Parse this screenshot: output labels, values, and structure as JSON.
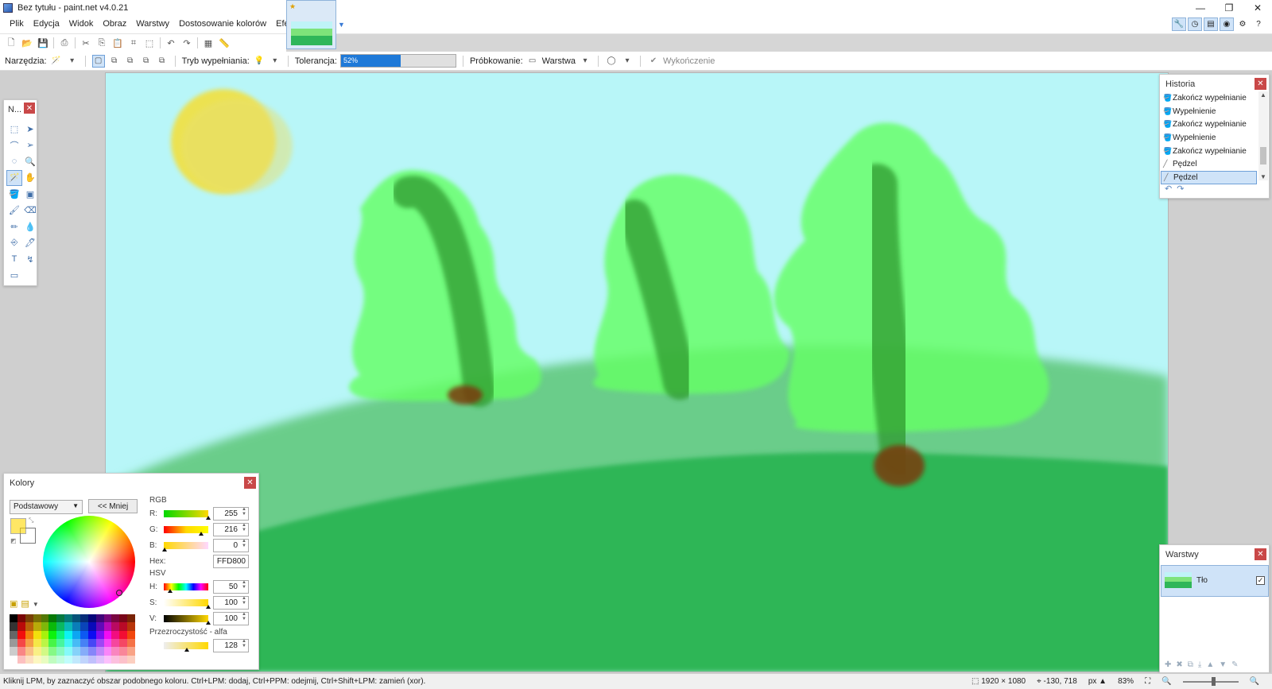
{
  "window": {
    "title": "Bez tytułu - paint.net v4.0.21"
  },
  "menu": [
    "Plik",
    "Edycja",
    "Widok",
    "Obraz",
    "Warstwy",
    "Dostosowanie kolorów",
    "Efekty"
  ],
  "toolbar": {
    "tools_label": "Narzędzia:",
    "fill_mode_label": "Tryb wypełniania:",
    "tolerance_label": "Tolerancja:",
    "tolerance_value": "52%",
    "tolerance_percent": 52,
    "sampling_label": "Próbkowanie:",
    "sampling_value": "Warstwa",
    "finish_label": "Wykończenie"
  },
  "tools_panel": {
    "title": "N..."
  },
  "history": {
    "title": "Historia",
    "items": [
      {
        "label": "Zakończ wypełnianie",
        "icon": "fill-icon"
      },
      {
        "label": "Wypełnienie",
        "icon": "fill-icon"
      },
      {
        "label": "Zakończ wypełnianie",
        "icon": "fill-icon"
      },
      {
        "label": "Wypełnienie",
        "icon": "fill-icon"
      },
      {
        "label": "Zakończ wypełnianie",
        "icon": "fill-icon"
      },
      {
        "label": "Pędzel",
        "icon": "brush-icon"
      },
      {
        "label": "Pędzel",
        "icon": "brush-icon"
      }
    ]
  },
  "layers": {
    "title": "Warstwy",
    "items": [
      {
        "name": "Tło",
        "visible": true
      }
    ]
  },
  "colors": {
    "title": "Kolory",
    "mode": "Podstawowy",
    "less_button": "<< Mniej",
    "primary": "#FFD800",
    "secondary": "#FFFFFF",
    "rgb_label": "RGB",
    "r_label": "R:",
    "r": "255",
    "g_label": "G:",
    "g": "216",
    "b_label": "B:",
    "b": "0",
    "hex_label": "Hex:",
    "hex": "FFD800",
    "hsv_label": "HSV",
    "h_label": "H:",
    "h": "50",
    "s_label": "S:",
    "s": "100",
    "v_label": "V:",
    "v": "100",
    "alpha_label": "Przezroczystość - alfa",
    "alpha": "128"
  },
  "status": {
    "hint": "Kliknij LPM, by zaznaczyć obszar podobnego koloru. Ctrl+LPM: dodaj, Ctrl+PPM: odejmij, Ctrl+Shift+LPM: zamień (xor).",
    "image_size": "1920 × 1080",
    "cursor": "-130, 718",
    "unit": "px",
    "zoom": "83%"
  },
  "scene_colors": {
    "sky": "#B8F6F8",
    "hill_light": "#6ACD8A",
    "hill_dark": "#2DB657",
    "tree": "#66FF66",
    "trunk": "#2E9A2E",
    "sun": "#F2E040",
    "root": "#7A3A10"
  }
}
